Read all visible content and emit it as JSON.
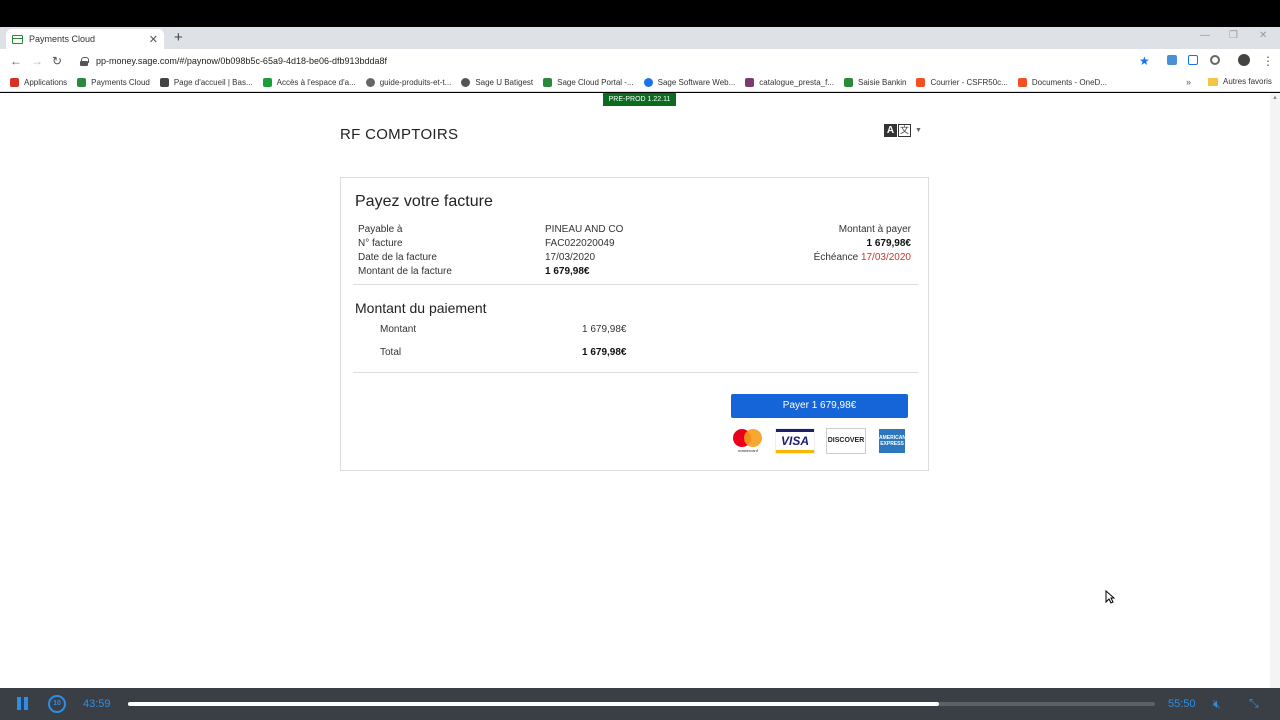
{
  "browser": {
    "tab_title": "Payments Cloud",
    "new_tab": "+",
    "url": "pp-money.sage.com/#/paynow/0b098b5c-65a9-4d18-be06-dfb913bdda8f",
    "bookmarks": [
      {
        "label": "Applications",
        "color": "#d93025"
      },
      {
        "label": "Payments Cloud",
        "color": "#2a8a3a"
      },
      {
        "label": "Page d'accueil | Bas...",
        "color": "#444444"
      },
      {
        "label": "Accès à l'espace d'a...",
        "color": "#1e9e3a"
      },
      {
        "label": "guide-produits-et-t...",
        "color": "#666666"
      },
      {
        "label": "Sage U Batigest",
        "color": "#555555"
      },
      {
        "label": "Sage Cloud Portal -...",
        "color": "#2a8a3a"
      },
      {
        "label": "Sage Software Web...",
        "color": "#1a73e8"
      },
      {
        "label": "catalogue_presta_f...",
        "color": "#7a3b6e"
      },
      {
        "label": "Saisie Bankin",
        "color": "#2a8a3a"
      },
      {
        "label": "Courrier - CSFR50c...",
        "color": "#f25022"
      },
      {
        "label": "Documents - OneD...",
        "color": "#f25022"
      }
    ],
    "more": "»",
    "other_bookmarks": "Autres favoris"
  },
  "page": {
    "env_badge": "PRE-PROD 1.22.11",
    "merchant": "RF COMPTOIRS",
    "title": "Payez votre facture",
    "payable_label": "Payable à",
    "payable_value": "PINEAU AND CO",
    "invoice_no_label": "N° facture",
    "invoice_no_value": "FAC022020049",
    "invoice_date_label": "Date de la facture",
    "invoice_date_value": "17/03/2020",
    "invoice_amount_label": "Montant de la facture",
    "invoice_amount_value": "1 679,98€",
    "due_label": "Montant à payer",
    "due_value": "1 679,98€",
    "deadline_label": "Échéance",
    "deadline_value": "17/03/2020",
    "payment_title": "Montant du paiement",
    "amount_label": "Montant",
    "amount_value": "1 679,98€",
    "total_label": "Total",
    "total_value": "1 679,98€",
    "pay_button": "Payer 1 679,98€",
    "logos": {
      "mastercard": "mastercard",
      "visa": "VISA",
      "discover": "DISCOVER",
      "amex": "AMERICAN EXPRESS"
    }
  },
  "player": {
    "rewind": "10",
    "elapsed": "43:59",
    "duration": "55:50",
    "progress": 0.79
  }
}
